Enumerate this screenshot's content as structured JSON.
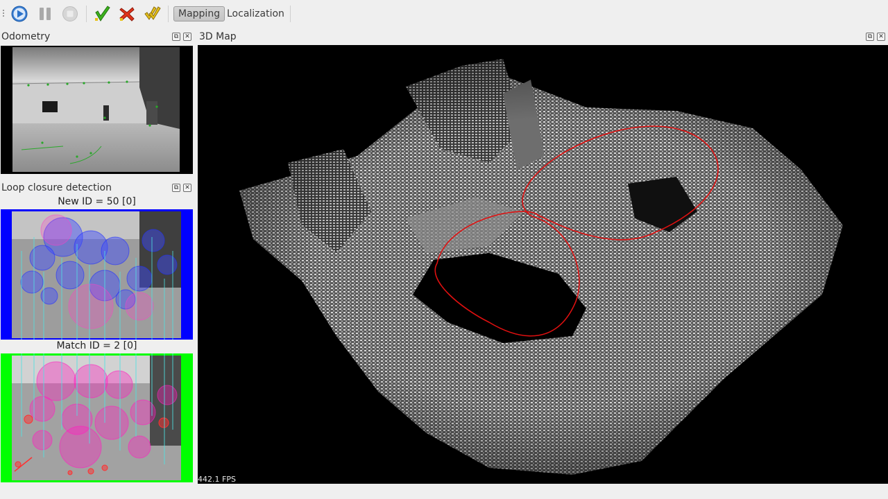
{
  "toolbar": {
    "buttons": [
      {
        "name": "play-button",
        "icon": "play-icon"
      },
      {
        "name": "pause-button",
        "icon": "pause-icon"
      },
      {
        "name": "stop-button",
        "icon": "stop-icon"
      },
      {
        "name": "accept-button",
        "icon": "checkmark-icon"
      },
      {
        "name": "reject-button",
        "icon": "cross-icon"
      },
      {
        "name": "accept-all-button",
        "icon": "double-check-icon"
      }
    ],
    "mode_mapping": "Mapping",
    "mode_localization": "Localization",
    "active_mode": "Mapping"
  },
  "odometry": {
    "title": "Odometry"
  },
  "loop_closure": {
    "title": "Loop closure detection",
    "new_id_caption": "New ID = 50 [0]",
    "match_id_caption": "Match ID = 2 [0]",
    "new_frame_color": "#0000ff",
    "match_frame_color": "#00ff00"
  },
  "map3d": {
    "title": "3D Map",
    "fps": "442.1 FPS",
    "trajectory_color": "#e01010"
  }
}
